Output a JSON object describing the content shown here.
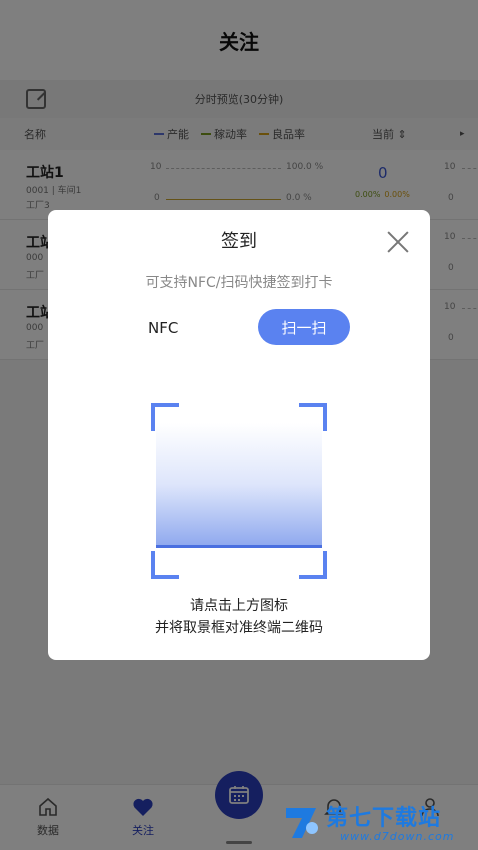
{
  "header": {
    "title": "关注"
  },
  "toolbar": {
    "preview_label": "分时预览(30分钟)"
  },
  "table_header": {
    "name_label": "名称",
    "legend": [
      {
        "label": "产能",
        "color": "#5b6fd6"
      },
      {
        "label": "稼动率",
        "color": "#7b9a1f"
      },
      {
        "label": "良品率",
        "color": "#d4a017"
      }
    ],
    "current_label": "当前 ⇕",
    "more_label": "▸"
  },
  "stations": [
    {
      "name": "工站1",
      "line2": "0001 | 车间1",
      "line3": "工厂3",
      "axis_top": "10",
      "axis_bottom": "0",
      "pct_top": "100.0 %",
      "pct_bottom": "0.0 %",
      "current": "0",
      "rate1": "0.00%",
      "rate2": "0.00%",
      "right_top": "10",
      "right_bottom": "0"
    },
    {
      "name": "工站",
      "line2": "000",
      "line3": "工厂",
      "axis_top": "10",
      "axis_bottom": "0",
      "pct_top": "",
      "pct_bottom": "",
      "current": "",
      "rate1": "",
      "rate2": "",
      "right_top": "10",
      "right_bottom": "0"
    },
    {
      "name": "工站",
      "line2": "000",
      "line3": "工厂",
      "axis_top": "10",
      "axis_bottom": "0",
      "pct_top": "",
      "pct_bottom": "",
      "current": "",
      "rate1": "",
      "rate2": "",
      "right_top": "10",
      "right_bottom": "0"
    }
  ],
  "dialog": {
    "title": "签到",
    "subtitle": "可支持NFC/扫码快捷签到打卡",
    "nfc_label": "NFC",
    "scan_label": "扫一扫",
    "hint_line1": "请点击上方图标",
    "hint_line2": "并将取景框对准终端二维码",
    "accent_color": "#5a82f0"
  },
  "bottom_nav": {
    "items": [
      {
        "label": "数据",
        "icon": "home-icon"
      },
      {
        "label": "关注",
        "icon": "heart-icon",
        "active": true
      },
      {
        "label": "",
        "icon": "calendar-icon"
      },
      {
        "label": "",
        "icon": "bell-icon"
      },
      {
        "label": "",
        "icon": "user-icon"
      }
    ]
  },
  "watermark": {
    "text": "第七下载站",
    "url_text": "www.d7down.com"
  }
}
